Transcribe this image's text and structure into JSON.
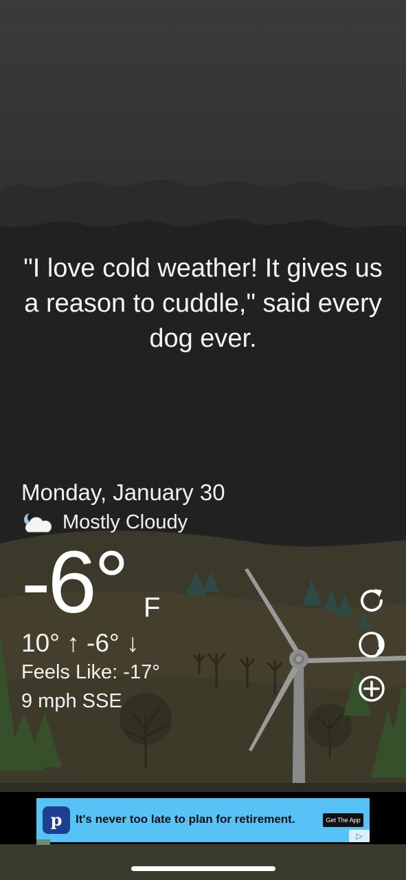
{
  "quote": "\"I love cold weather! It gives us a reason to cuddle,\" said every dog ever.",
  "weather": {
    "date": "Monday, January 30",
    "condition": "Mostly Cloudy",
    "condition_icon": "partly-cloudy-night-icon",
    "temperature": "-6°",
    "unit": "F",
    "hi_lo": "10° ↑ -6° ↓",
    "feels_like": "Feels Like: -17°",
    "wind": "9 mph SSE"
  },
  "controls": [
    {
      "name": "refresh",
      "icon": "refresh-icon"
    },
    {
      "name": "moon",
      "icon": "moon-phase-icon"
    },
    {
      "name": "add",
      "icon": "plus-circle-icon"
    }
  ],
  "ad": {
    "logo_letter": "p",
    "text": "It's never too late to plan for retirement.",
    "cta": "Get The App",
    "choice_icon": "▷"
  },
  "colors": {
    "sky": "#1f1f1f",
    "ground": "#3a3a28",
    "ad_background": "#56c2f6"
  }
}
